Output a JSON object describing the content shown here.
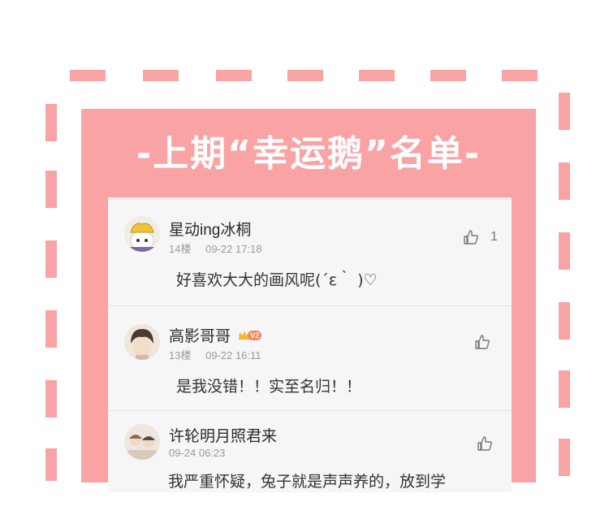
{
  "banner": {
    "title": "-上期“幸运鹅”名单-"
  },
  "comments": [
    {
      "user": "星动ing冰桐",
      "floor": "14楼",
      "time": "09-22 17:18",
      "text": "好喜欢大大的画风呢(´ε｀ )♡",
      "likes": "1",
      "avatar_icon": "avatar-chef-hat"
    },
    {
      "user": "高影哥哥",
      "floor": "13楼",
      "time": "09-22 16:11",
      "text": "是我没错！！实至名归！！",
      "likes": "",
      "vip_label": "V2",
      "avatar_icon": "avatar-dark-hair"
    },
    {
      "user": "许轮明月照君来",
      "floor": "",
      "time": "09-24 06:23",
      "text": "我严重怀疑，兔子就是声声养的，放到学",
      "likes": "",
      "avatar_icon": "avatar-group"
    }
  ],
  "colors": {
    "frame": "#f8a4a4",
    "card": "#f9a3a4",
    "panel": "#f6f6f8"
  }
}
